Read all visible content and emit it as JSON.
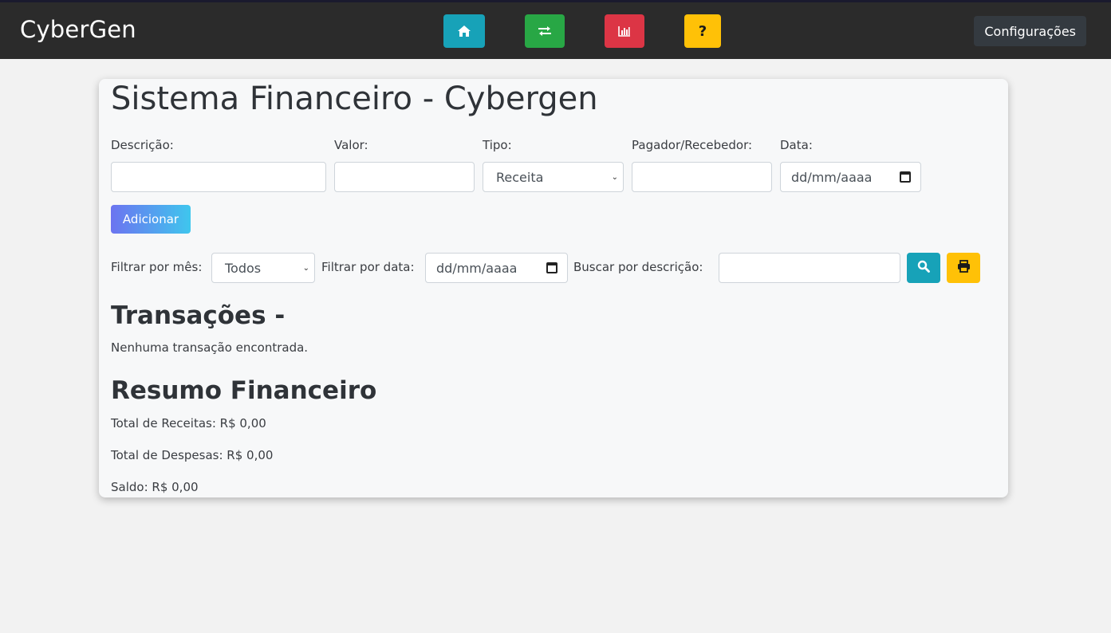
{
  "navbar": {
    "brand": "CyberGen",
    "home_icon": "home-icon",
    "transfer_icon": "exchange-arrows-icon",
    "chart_icon": "bar-chart-icon",
    "help_label": "?",
    "config_label": "Configurações"
  },
  "main": {
    "title": "Sistema Financeiro - Cybergen",
    "form": {
      "descricao_label": "Descrição:",
      "descricao_value": "",
      "valor_label": "Valor:",
      "valor_value": "",
      "tipo_label": "Tipo:",
      "tipo_value": "Receita",
      "pagador_label": "Pagador/Recebedor:",
      "pagador_value": "",
      "data_label": "Data:",
      "data_placeholder": "dd/mm/aaaa",
      "add_label": "Adicionar"
    },
    "filters": {
      "mes_label": "Filtrar por mês:",
      "mes_value": "Todos",
      "data_label": "Filtrar por data:",
      "data_placeholder": "dd/mm/aaaa",
      "busca_label": "Buscar por descrição:",
      "busca_value": "",
      "search_icon": "search-icon",
      "print_icon": "print-icon"
    },
    "transacoes": {
      "heading": "Transações -",
      "empty_message": "Nenhuma transação encontrada."
    },
    "resumo": {
      "heading": "Resumo Financeiro",
      "receitas": "Total de Receitas: R$ 0,00",
      "despesas": "Total de Despesas: R$ 0,00",
      "saldo": "Saldo: R$ 0,00"
    }
  },
  "colors": {
    "navbar_bg": "#2b2b2b",
    "home": "#17a2b8",
    "transfer": "#28a745",
    "chart": "#dc3545",
    "help": "#ffc107",
    "add_gradient_start": "#6c74f0",
    "add_gradient_end": "#3fc6ee"
  }
}
